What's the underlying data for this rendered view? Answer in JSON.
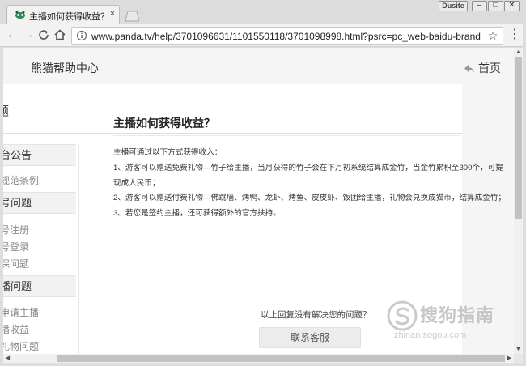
{
  "browser": {
    "tab_title": "主播如何获得收益？_熊猫",
    "tab_close": "×",
    "url": "www.panda.tv/help/3701096631/1101550118/3701098998.html?psrc=pc_web-baidu-brand",
    "user_label": "Dusite",
    "window_buttons": {
      "minimize": "–",
      "maximize": "□",
      "close": "✕"
    },
    "nav": {
      "back": "←",
      "forward": "→",
      "reload": "C",
      "home": "⌂",
      "star": "☆",
      "menu": "⋮"
    }
  },
  "page": {
    "help_center_title": "熊猫帮助中心",
    "home_link": "首页",
    "card_header": "题",
    "sidebar": {
      "sections": [
        {
          "label": "台公告",
          "items": [
            "规范条例"
          ]
        },
        {
          "label": "号问题",
          "items": [
            "号注册",
            "号登录",
            "保问题"
          ]
        },
        {
          "label": "播问题",
          "items": [
            "申请主播",
            "播收益",
            "礼物问题"
          ]
        }
      ]
    },
    "article": {
      "title": "主播如何获得收益？",
      "intro": "主播可通过以下方式获得收入：",
      "points": [
        "1、游客可以赠送免费礼物—竹子给主播，当月获得的竹子会在下月初系统结算成金竹，当金竹累积至300个，可提现成人民币；",
        "2、游客可以赠送付费礼物—佛跳墙、烤鸭、龙虾、烤鱼、皮皮虾、饭团给主播，礼物会兑换成猫币，结算成金竹；",
        "3、若您是签约主播，还可获得额外的官方扶持。"
      ]
    },
    "unsolved_text": "以上回复没有解决您的问题？",
    "contact_button": "联系客服",
    "watermark": {
      "text": "搜狗指南",
      "sub": "zhinan.sogou.com"
    }
  },
  "scroll": {
    "up": "▲",
    "down": "▼",
    "left": "◀",
    "right": "▶"
  }
}
